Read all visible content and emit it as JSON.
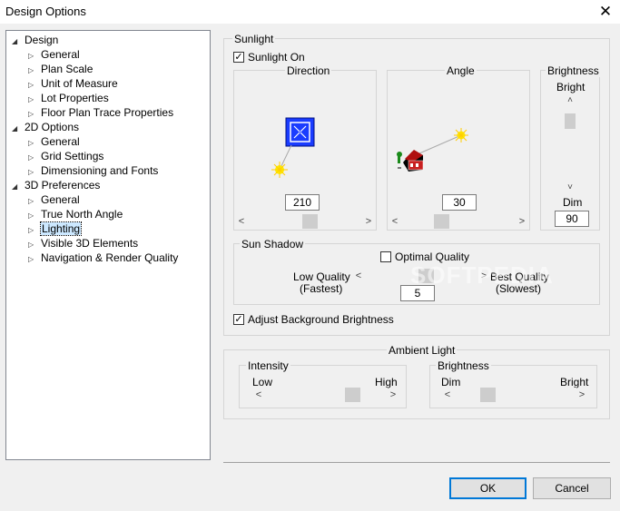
{
  "window": {
    "title": "Design Options"
  },
  "tree": [
    {
      "label": "Design",
      "level": 0,
      "toggle": "◢"
    },
    {
      "label": "General",
      "level": 1,
      "toggle": "▷"
    },
    {
      "label": "Plan Scale",
      "level": 1,
      "toggle": "▷"
    },
    {
      "label": "Unit of Measure",
      "level": 1,
      "toggle": "▷"
    },
    {
      "label": "Lot Properties",
      "level": 1,
      "toggle": "▷"
    },
    {
      "label": "Floor Plan Trace Properties",
      "level": 1,
      "toggle": "▷"
    },
    {
      "label": "2D Options",
      "level": 0,
      "toggle": "◢"
    },
    {
      "label": "General",
      "level": 1,
      "toggle": "▷"
    },
    {
      "label": "Grid Settings",
      "level": 1,
      "toggle": "▷"
    },
    {
      "label": "Dimensioning and Fonts",
      "level": 1,
      "toggle": "▷"
    },
    {
      "label": "3D Preferences",
      "level": 0,
      "toggle": "◢"
    },
    {
      "label": "General",
      "level": 1,
      "toggle": "▷"
    },
    {
      "label": "True North Angle",
      "level": 1,
      "toggle": "▷"
    },
    {
      "label": "Lighting",
      "level": 1,
      "toggle": "▷",
      "selected": true
    },
    {
      "label": "Visible 3D Elements",
      "level": 1,
      "toggle": "▷"
    },
    {
      "label": "Navigation & Render Quality",
      "level": 1,
      "toggle": "▷"
    }
  ],
  "sunlight": {
    "group_label": "Sunlight",
    "sunlight_on_label": "Sunlight On",
    "sunlight_on_check": "✓",
    "direction": {
      "label": "Direction",
      "value": "210",
      "slider_fraction": 0.55
    },
    "angle": {
      "label": "Angle",
      "value": "30",
      "slider_fraction": 0.33
    },
    "brightness": {
      "label": "Brightness",
      "top": "Bright",
      "bottom": "Dim",
      "value": "90",
      "slider_fraction": 0.1
    },
    "shadow": {
      "group_label": "Sun Shadow",
      "optimal_label": "Optimal Quality",
      "low_line1": "Low Quality",
      "low_line2": "(Fastest)",
      "best_line1": "Best Quality",
      "best_line2": "(Slowest)",
      "value": "5",
      "slider_fraction": 0.55
    },
    "adjust_bg_label": "Adjust Background Brightness",
    "adjust_bg_check": "✓"
  },
  "ambient": {
    "group_label": "Ambient Light",
    "intensity": {
      "label": "Intensity",
      "low": "Low",
      "high": "High",
      "slider_fraction": 0.75
    },
    "brightness": {
      "label": "Brightness",
      "low": "Dim",
      "high": "Bright",
      "slider_fraction": 0.25
    }
  },
  "buttons": {
    "ok": "OK",
    "cancel": "Cancel"
  },
  "colors": {
    "selection": "#cce8ff",
    "default_button_border": "#0078d7",
    "compass_blue": "#1a3cff",
    "sun_yellow": "#ffee00"
  },
  "watermark": "SOFTPEDIA"
}
